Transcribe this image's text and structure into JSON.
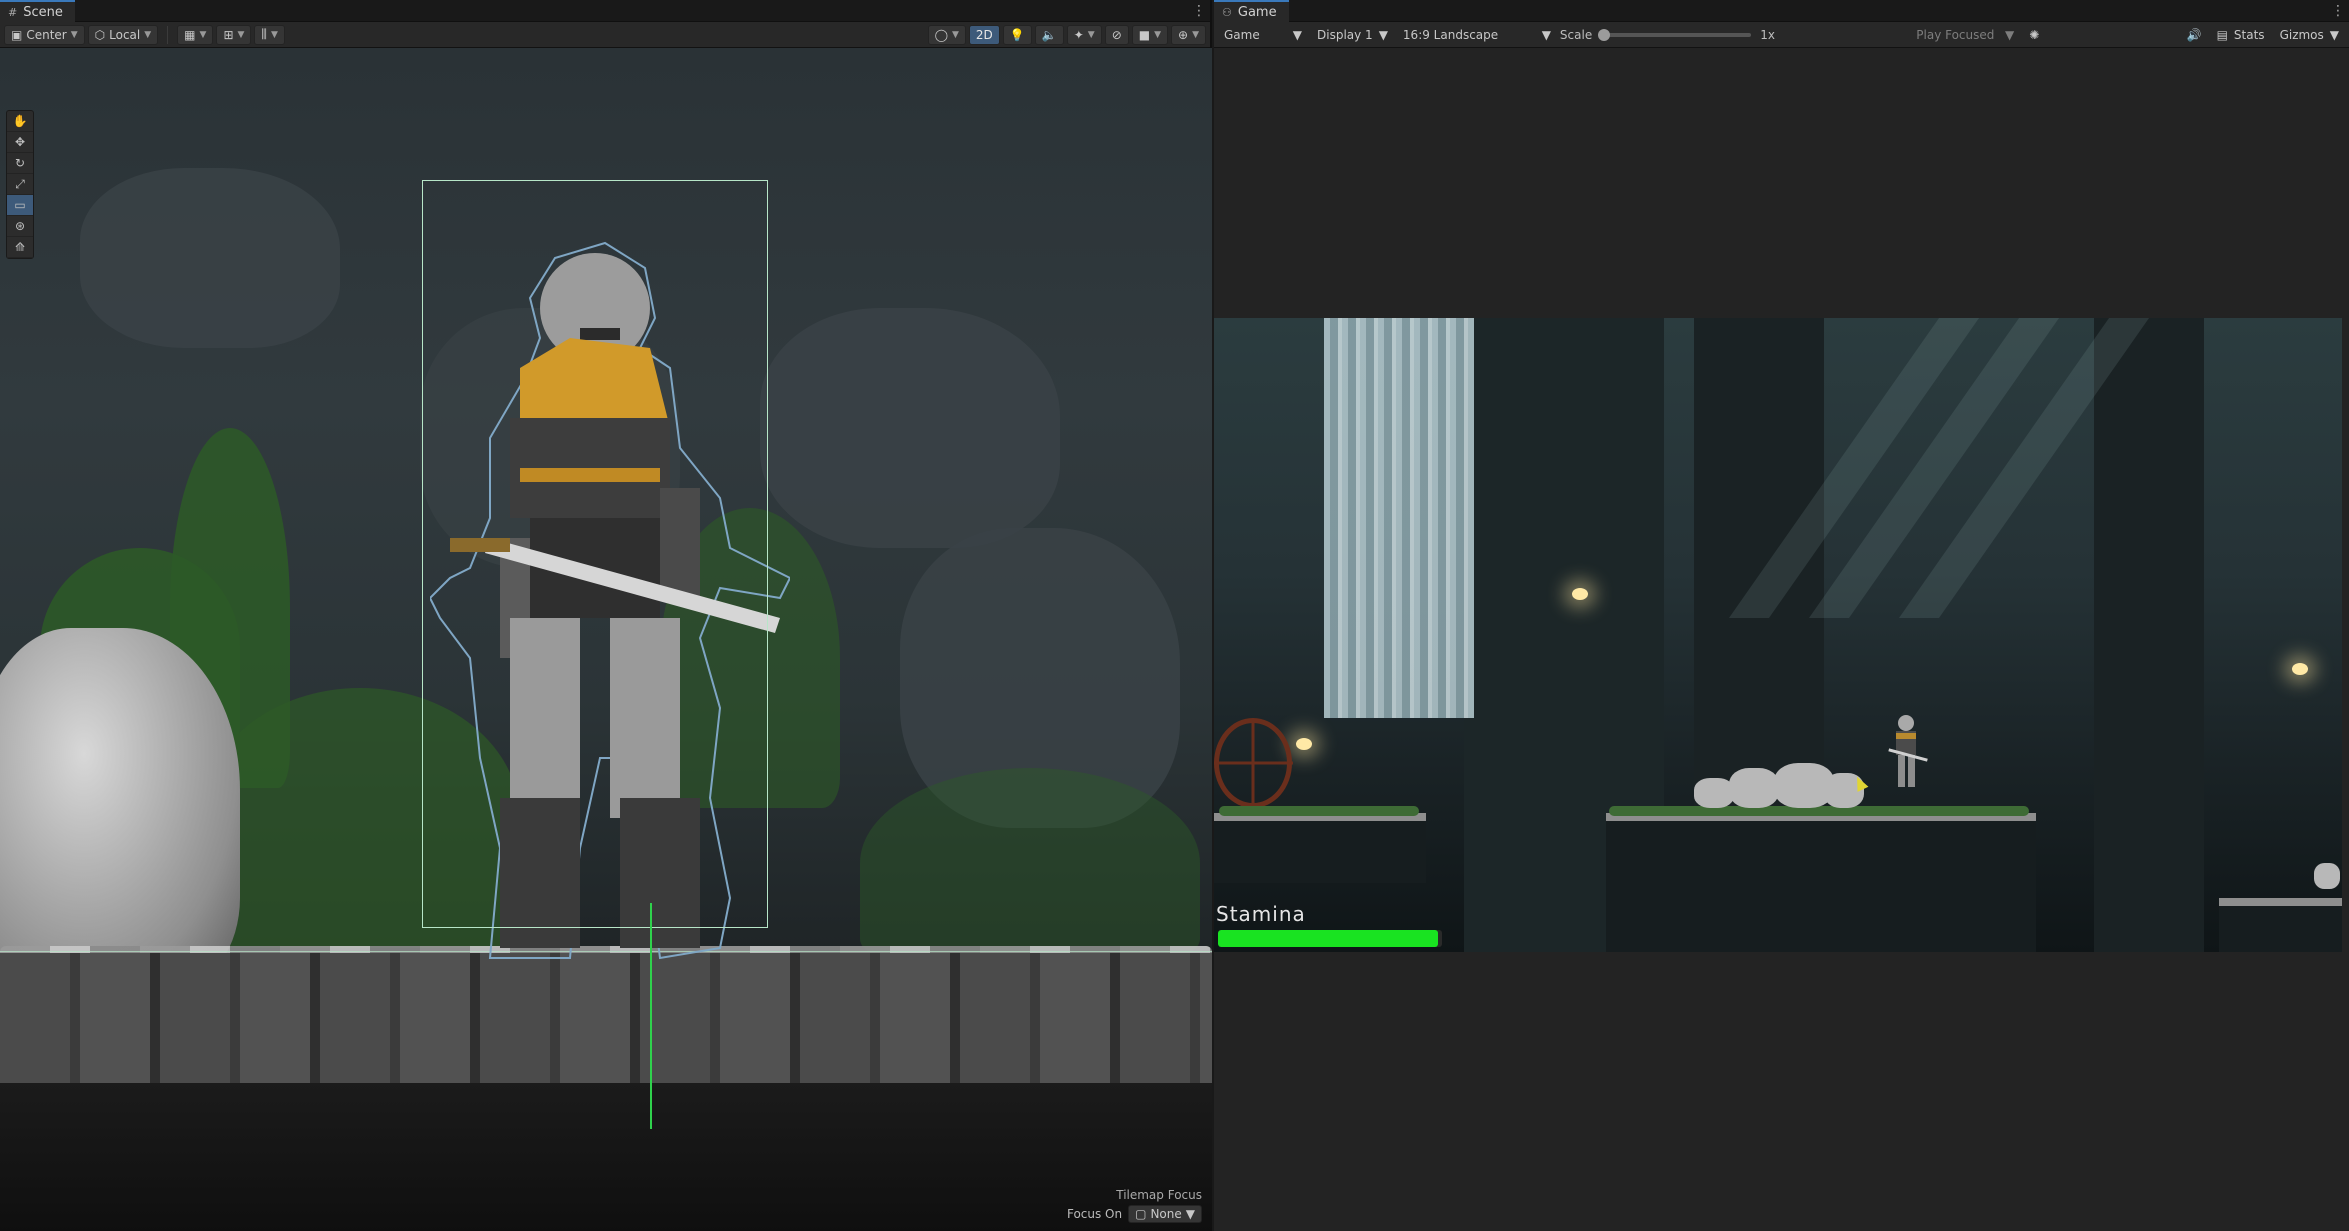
{
  "scene": {
    "tab_label": "Scene",
    "toolbar": {
      "pivot_label": "Center",
      "space_label": "Local",
      "mode_2d_label": "2D"
    },
    "tools": [
      "hand-tool",
      "move-tool",
      "rotate-tool",
      "scale-tool",
      "rect-tool",
      "transform-tool",
      "custom-tool"
    ],
    "overlay": {
      "title": "Tilemap Focus",
      "focus_label": "Focus On",
      "focus_value": "None"
    }
  },
  "game": {
    "tab_label": "Game",
    "toolbar": {
      "view_select": "Game",
      "display_select": "Display 1",
      "aspect_select": "16:9 Landscape",
      "scale_label": "Scale",
      "scale_value": "1x",
      "play_mode_select": "Play Focused",
      "stats_label": "Stats",
      "gizmos_label": "Gizmos"
    },
    "hud": {
      "stamina_label": "Stamina",
      "stamina_fraction": 0.98
    }
  },
  "colors": {
    "accent": "#3d5a7a",
    "selection": "#b7e6c8",
    "pivot": "#2fd24c",
    "stamina": "#19e321"
  }
}
